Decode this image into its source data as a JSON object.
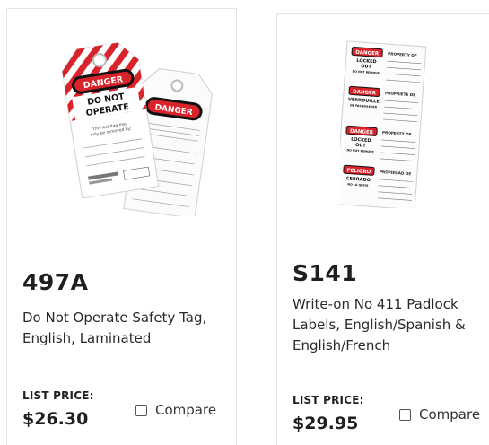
{
  "products": [
    {
      "sku": "497A",
      "description": "Do Not Operate Safety Tag, English, Laminated",
      "price_label": "LIST PRICE:",
      "price": "$26.30",
      "compare_label": "Compare",
      "image": {
        "tag_front": {
          "header": "DANGER",
          "title": [
            "DO NOT",
            "OPERATE"
          ],
          "note": [
            "This lock/tag may",
            "only be removed by:"
          ]
        },
        "tag_back": {
          "header": "DANGER"
        }
      }
    },
    {
      "sku": "S141",
      "description": "Write-on No 411 Padlock Labels, English/Spanish & English/French",
      "price_label": "LIST PRICE:",
      "price": "$29.95",
      "compare_label": "Compare",
      "image": {
        "labels": [
          {
            "badge": "DANGER",
            "lines": [
              "LOCKED",
              "OUT",
              "DO NOT REMOVE"
            ],
            "side": "PROPERTY OF"
          },
          {
            "badge": "DANGER",
            "lines": [
              "VERROUILLE",
              "NE PAS ENLEVER"
            ],
            "side": "PROPRIETE DE"
          },
          {
            "badge": "DANGER",
            "lines": [
              "LOCKED",
              "OUT",
              "DO NOT REMOVE"
            ],
            "side": "PROPERTY OF"
          },
          {
            "badge": "PELIGRO",
            "lines": [
              "CERRADO",
              "NO LO QUITE"
            ],
            "side": "PROPIEDAD DE"
          }
        ]
      }
    }
  ],
  "colors": {
    "danger_red": "#d8232a",
    "text_dark": "#1f1f1f",
    "card_border": "#e4e4e4"
  }
}
